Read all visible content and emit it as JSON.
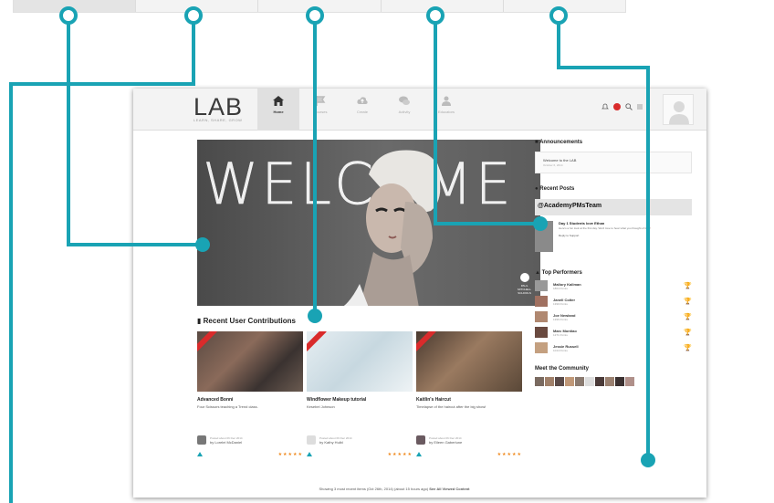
{
  "app": {
    "logo": "LAB",
    "tagline": "LEARN, SHARE, GROW"
  },
  "nav": [
    {
      "label": "Home",
      "icon": "home-icon",
      "active": true
    },
    {
      "label": "Courses",
      "icon": "flag-icon",
      "active": false
    },
    {
      "label": "Create",
      "icon": "cloud-upload-icon",
      "active": false
    },
    {
      "label": "Activity",
      "icon": "chat-icon",
      "active": false
    },
    {
      "label": "Educators",
      "icon": "users-icon",
      "active": false
    }
  ],
  "banner": {
    "headline": "WELCOME",
    "brand": [
      "PAUL",
      "MITCHELL",
      "SCHOOLS"
    ]
  },
  "contributions": {
    "title": "Recent User Contributions",
    "items": [
      {
        "title": "Advanced Bonni",
        "desc": "Four Scissors teaching a Trend class.",
        "posted": "Posted about 06 Dec 2014",
        "by": "by Lorelei McDaniel"
      },
      {
        "title": "Windflower Makeup tutorial",
        "desc": "Kesebel Johnson",
        "posted": "Posted about 06 Dec 2014",
        "by": "by Kathy Hulbl"
      },
      {
        "title": "Kaitlin's Haircut",
        "desc": "Timelapse of the haircut after the big show!",
        "posted": "Posted about 06 Dec 2014",
        "by": "by Eileen Gaberlune"
      }
    ],
    "showing": "Showing 3 most recent items (Oct 26th, 2014) (about 15 hours ago)",
    "see_all": "See All Viewed Content"
  },
  "sidebar": {
    "announcements_title": "Announcements",
    "announcement": {
      "text": "Welcome to the LAB",
      "date": "October 6, 2014"
    },
    "recent_posts_title": "Recent Posts",
    "team": "@AcademyPMsTeam",
    "post": {
      "title": "Day 1 Students love Ethan",
      "body": "Here's a fun look at the first day. We'd love to hear what you thought of it all!",
      "reply": "Reply to Support"
    },
    "top_performers_title": "Top Performers",
    "performers": [
      {
        "name": "Mallory Kallman",
        "points": "1864 Points"
      },
      {
        "name": "Janell Colter",
        "points": "1399 Points"
      },
      {
        "name": "Joe Newland",
        "points": "1396 Points"
      },
      {
        "name": "Marc Montiao",
        "points": "1271 Points"
      },
      {
        "name": "Jessie Russell",
        "points": "1044 Points"
      }
    ],
    "community_title": "Meet the Community"
  },
  "colors": {
    "callout": "#19a3b4",
    "accent": "#d92b2b",
    "stars": "#f08a1e"
  }
}
